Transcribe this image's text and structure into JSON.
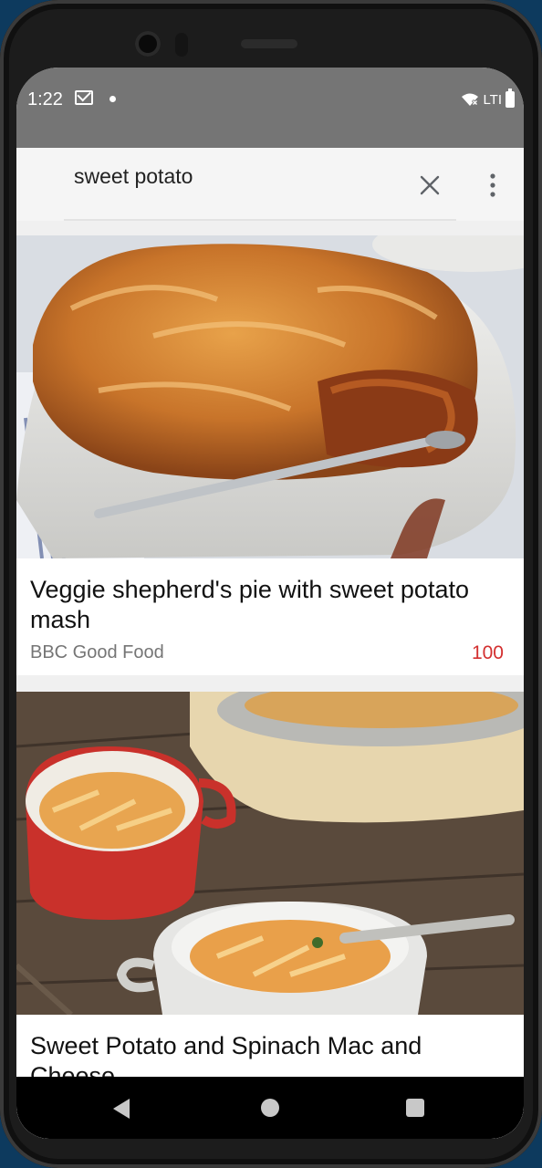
{
  "status_bar": {
    "time": "1:22",
    "network": "LTI"
  },
  "search": {
    "query": "sweet potato"
  },
  "results": [
    {
      "title": "Veggie shepherd's pie with sweet potato mash",
      "source": "BBC Good Food",
      "score": "100"
    },
    {
      "title": "Sweet Potato and Spinach Mac and Cheese",
      "source": "",
      "score": ""
    }
  ],
  "colors": {
    "status_bar": "#757575",
    "search_bar": "#f5f5f5",
    "score": "#d32f2f"
  }
}
